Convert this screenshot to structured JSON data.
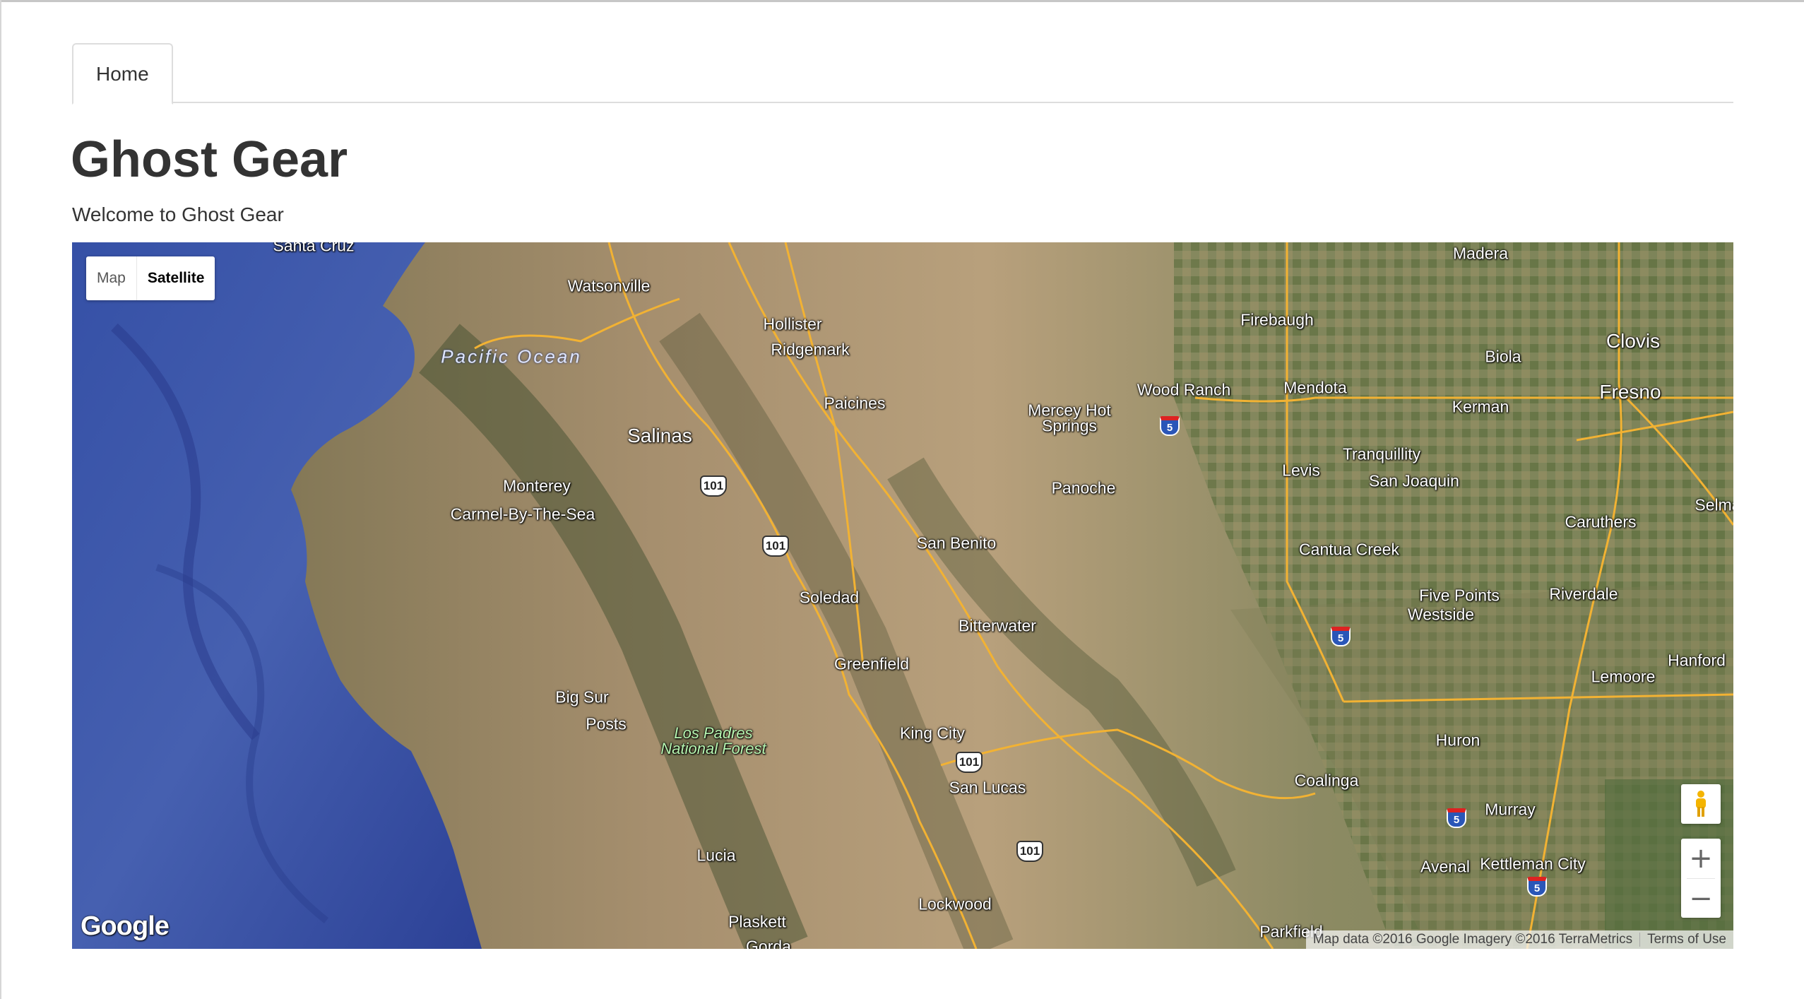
{
  "nav": {
    "tabs": [
      {
        "label": "Home",
        "active": true
      }
    ]
  },
  "header": {
    "title": "Ghost Gear",
    "subtitle": "Welcome to Ghost Gear"
  },
  "map": {
    "type_controls": {
      "map_label": "Map",
      "satellite_label": "Satellite",
      "selected": "Satellite"
    },
    "zoom": {
      "in_label": "+",
      "out_label": "−"
    },
    "logo": "Google",
    "attribution": "Map data ©2016 Google Imagery ©2016 TerraMetrics",
    "terms_label": "Terms of Use",
    "places": {
      "santa_cruz": "Santa Cruz",
      "watsonville": "Watsonville",
      "hollister": "Hollister",
      "ridgemark": "Ridgemark",
      "paicines": "Paicines",
      "salinas": "Salinas",
      "monterey": "Monterey",
      "carmel": "Carmel-By-The-Sea",
      "pacific_ocean": "Pacific Ocean",
      "mercey_hot_springs_line1": "Mercey Hot",
      "mercey_hot_springs_line2": "Springs",
      "panoche": "Panoche",
      "san_benito": "San Benito",
      "soledad": "Soledad",
      "bitterwater": "Bitterwater",
      "greenfield": "Greenfield",
      "big_sur": "Big Sur",
      "posts": "Posts",
      "los_padres_line1": "Los Padres",
      "los_padres_line2": "National Forest",
      "king_city": "King City",
      "san_lucas": "San Lucas",
      "lucia": "Lucia",
      "lockwood": "Lockwood",
      "plaskett": "Plaskett",
      "gorda": "Gorda",
      "parkfield": "Parkfield",
      "wood_ranch": "Wood Ranch",
      "firebaugh": "Firebaugh",
      "madera": "Madera",
      "mendota": "Mendota",
      "biola": "Biola",
      "clovis": "Clovis",
      "fresno": "Fresno",
      "kerman": "Kerman",
      "tranquillity": "Tranquillity",
      "san_joaquin": "San Joaquin",
      "levis": "Levis",
      "cantua_creek": "Cantua Creek",
      "caruthers": "Caruthers",
      "selma": "Selma",
      "five_points": "Five Points",
      "westside": "Westside",
      "riverdale": "Riverdale",
      "hanford": "Hanford",
      "lemoore": "Lemoore",
      "huron": "Huron",
      "coalinga": "Coalinga",
      "murray": "Murray",
      "avenal": "Avenal",
      "kettleman_city": "Kettleman City"
    },
    "route_shields": {
      "us101_a": "101",
      "us101_b": "101",
      "us101_c": "101",
      "us101_d": "101",
      "i5_a": "5",
      "i5_b": "5",
      "i5_c": "5",
      "i5_d": "5"
    }
  },
  "colors": {
    "ocean": "#3f5aa8",
    "land": "#a59275",
    "roads": "#f2b233",
    "text": "#333333"
  }
}
